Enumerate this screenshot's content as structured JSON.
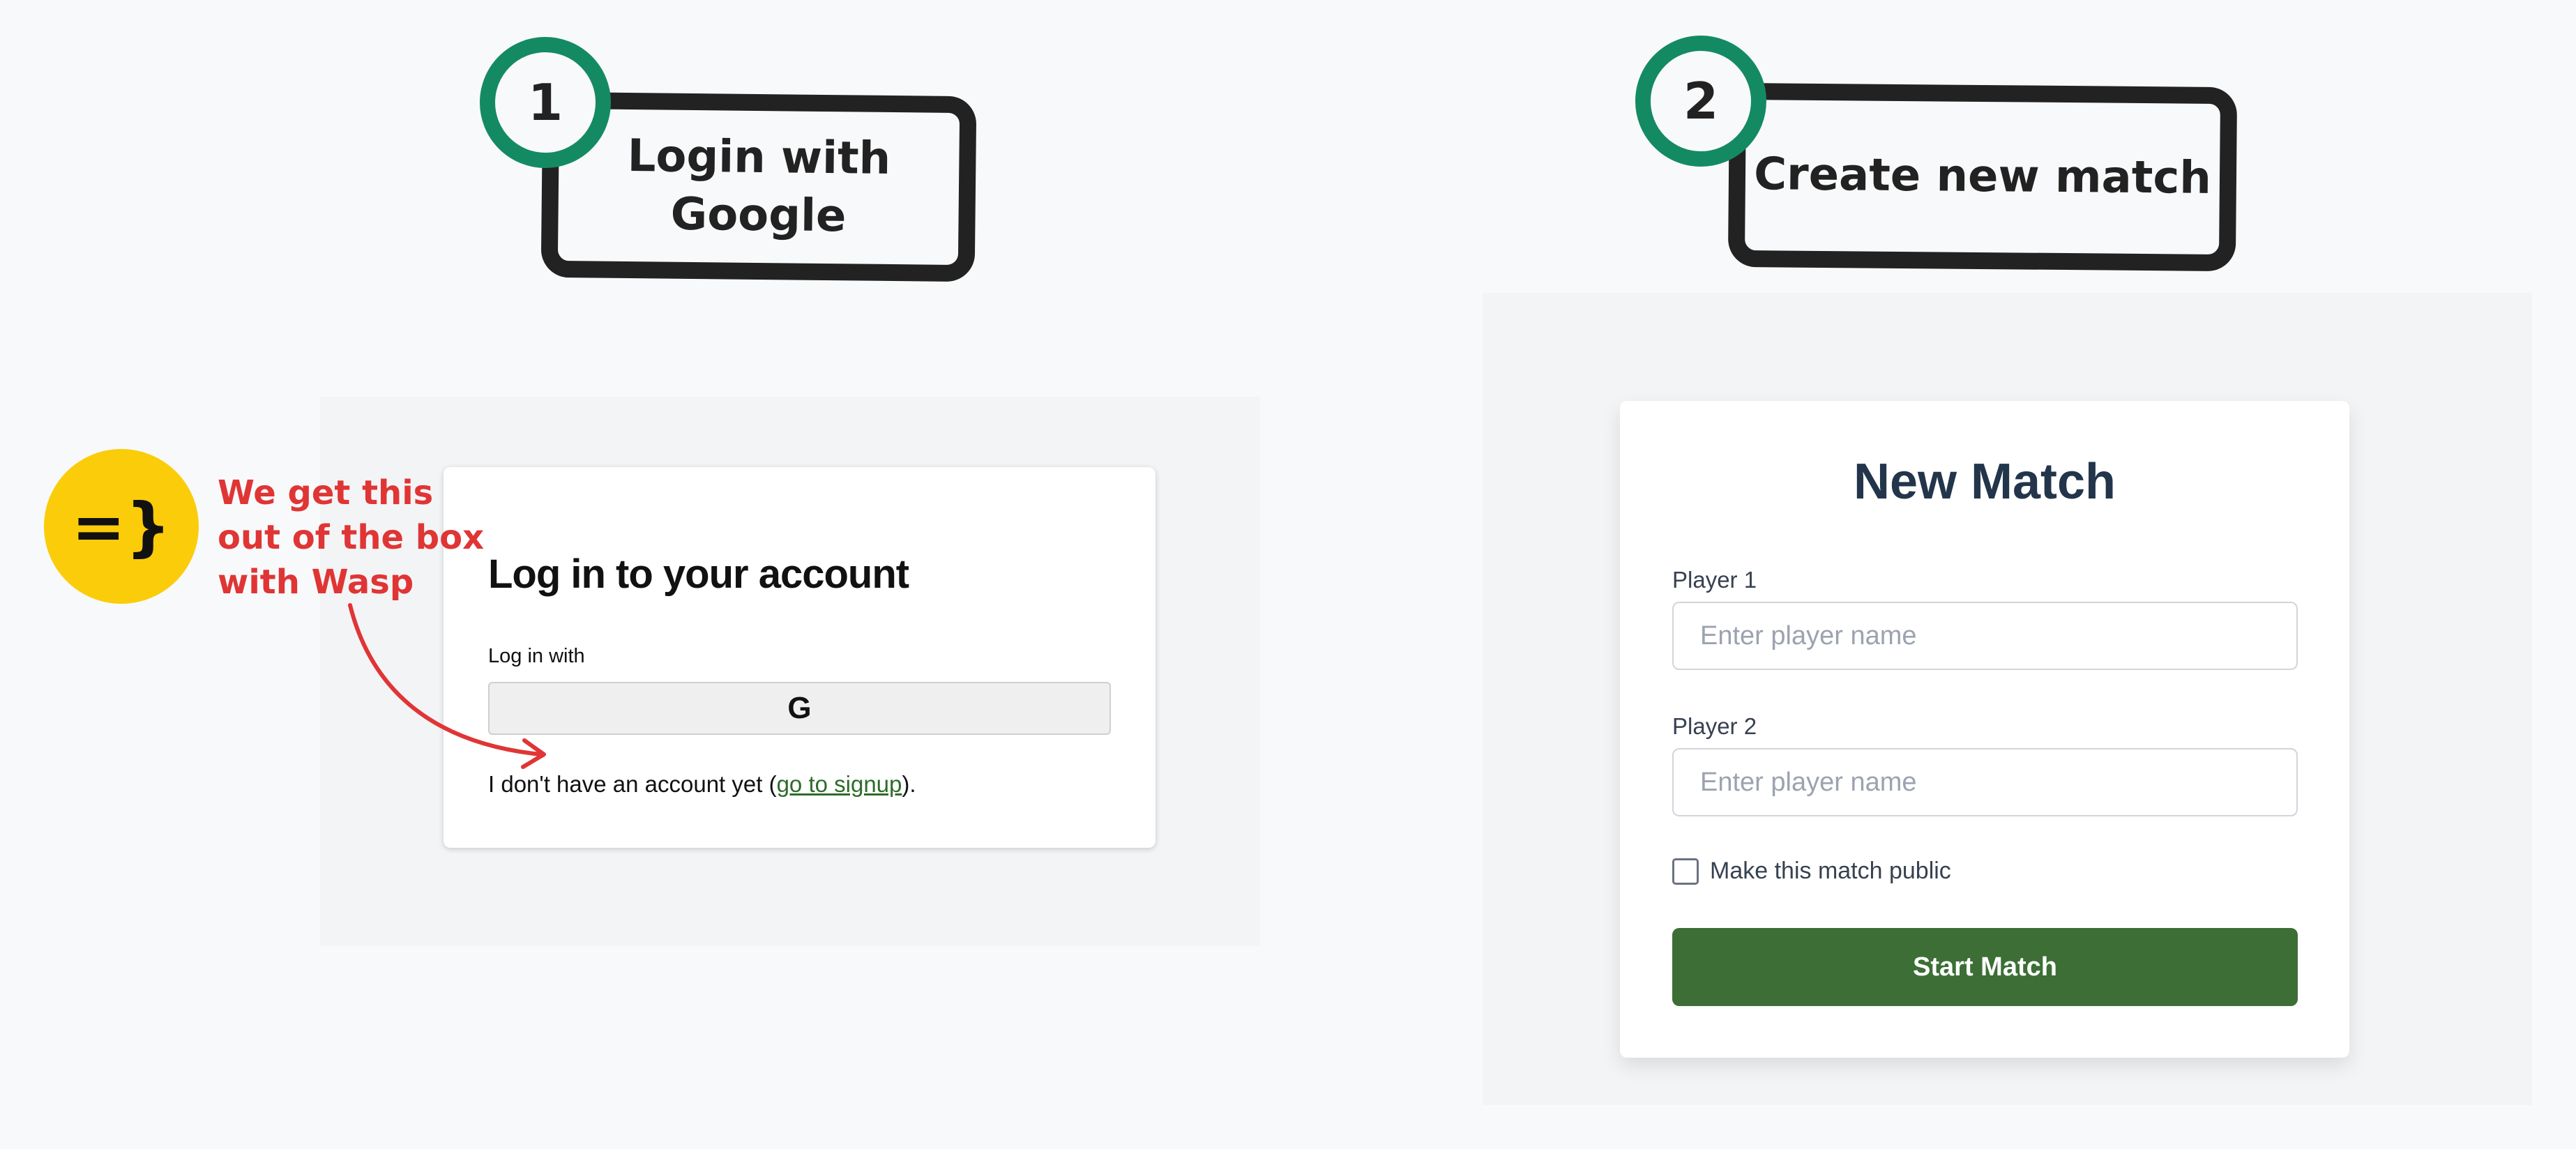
{
  "step1": {
    "number": "1",
    "label_line1": "Login with",
    "label_line2": "Google"
  },
  "step2": {
    "number": "2",
    "label": "Create new match"
  },
  "login": {
    "title": "Log in to your account",
    "subtitle": "Log in with",
    "google_button": "G",
    "signup_prefix": "I don't have an account yet (",
    "signup_link": "go to signup",
    "signup_suffix": ")."
  },
  "annotation": {
    "badge": "=}",
    "line1": "We get this",
    "line2": "out of the box",
    "line3": "with Wasp",
    "color": "#e03535"
  },
  "new_match": {
    "title": "New Match",
    "player1_label": "Player 1",
    "player1_placeholder": "Enter player name",
    "player2_label": "Player 2",
    "player2_placeholder": "Enter player name",
    "public_label": "Make this match public",
    "start_button": "Start Match"
  },
  "colors": {
    "background": "#f8f9fa",
    "step_ring": "#148a63",
    "badge_yellow": "#fbcc0a",
    "primary_button": "#3c6e35",
    "title_navy": "#23354b"
  }
}
